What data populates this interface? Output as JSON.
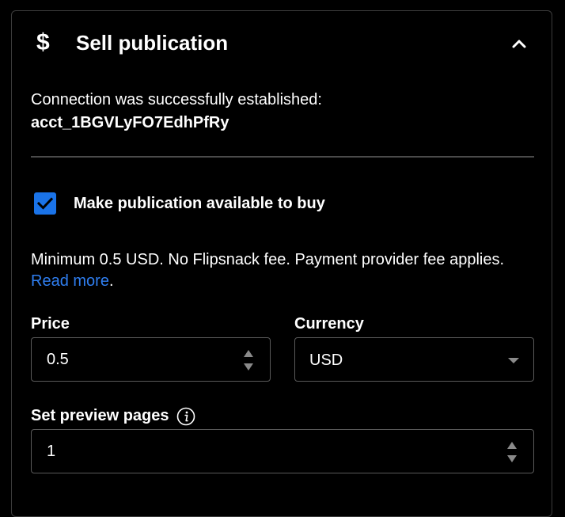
{
  "panel": {
    "title": "Sell publication",
    "title_icon": "dollar-icon",
    "collapse_icon": "chevron-up-icon"
  },
  "connection": {
    "message": "Connection was successfully established:",
    "account_id": "acct_1BGVLyFO7EdhPfRy"
  },
  "availability": {
    "checked": true,
    "label": "Make publication available to buy"
  },
  "info": {
    "text": "Minimum 0.5 USD. No Flipsnack fee. Payment provider fee applies.",
    "link": "Read more",
    "suffix": "."
  },
  "price": {
    "label": "Price",
    "value": "0.5"
  },
  "currency": {
    "label": "Currency",
    "value": "USD"
  },
  "preview": {
    "label": "Set preview pages",
    "value": "1",
    "info_icon": "info-icon"
  },
  "colors": {
    "background": "#000000",
    "accent": "#1a73e8",
    "link": "#2f7ef0",
    "border": "#5a5a5a"
  }
}
